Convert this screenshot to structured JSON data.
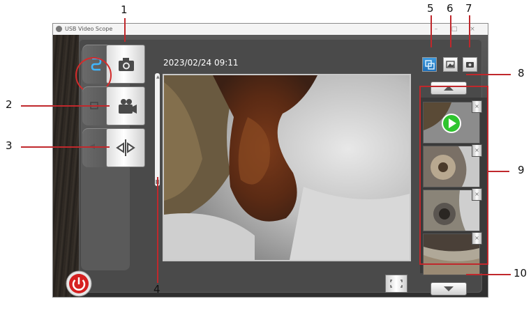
{
  "window": {
    "title": "USB Video Scope",
    "controls": [
      "–",
      "□",
      "×"
    ]
  },
  "toolbar": {
    "timestamp": "2023/02/24 09:11"
  },
  "thumbnails": {
    "count": 4,
    "delete_label": "×"
  },
  "callouts": [
    "1",
    "2",
    "3",
    "4",
    "5",
    "6",
    "7",
    "8",
    "9",
    "10"
  ],
  "colors": {
    "callout_line": "#c0282c",
    "link_icon": "#3fb6ff",
    "play_icon": "#2ec42e",
    "power_button": "#d62020"
  },
  "icons": {
    "tab1": "camera-icon",
    "tab2": "video-camera-icon",
    "tab3": "mirror-flip-icon",
    "link": "link-icon",
    "power": "power-icon",
    "fullscreen": "fullscreen-icon"
  }
}
